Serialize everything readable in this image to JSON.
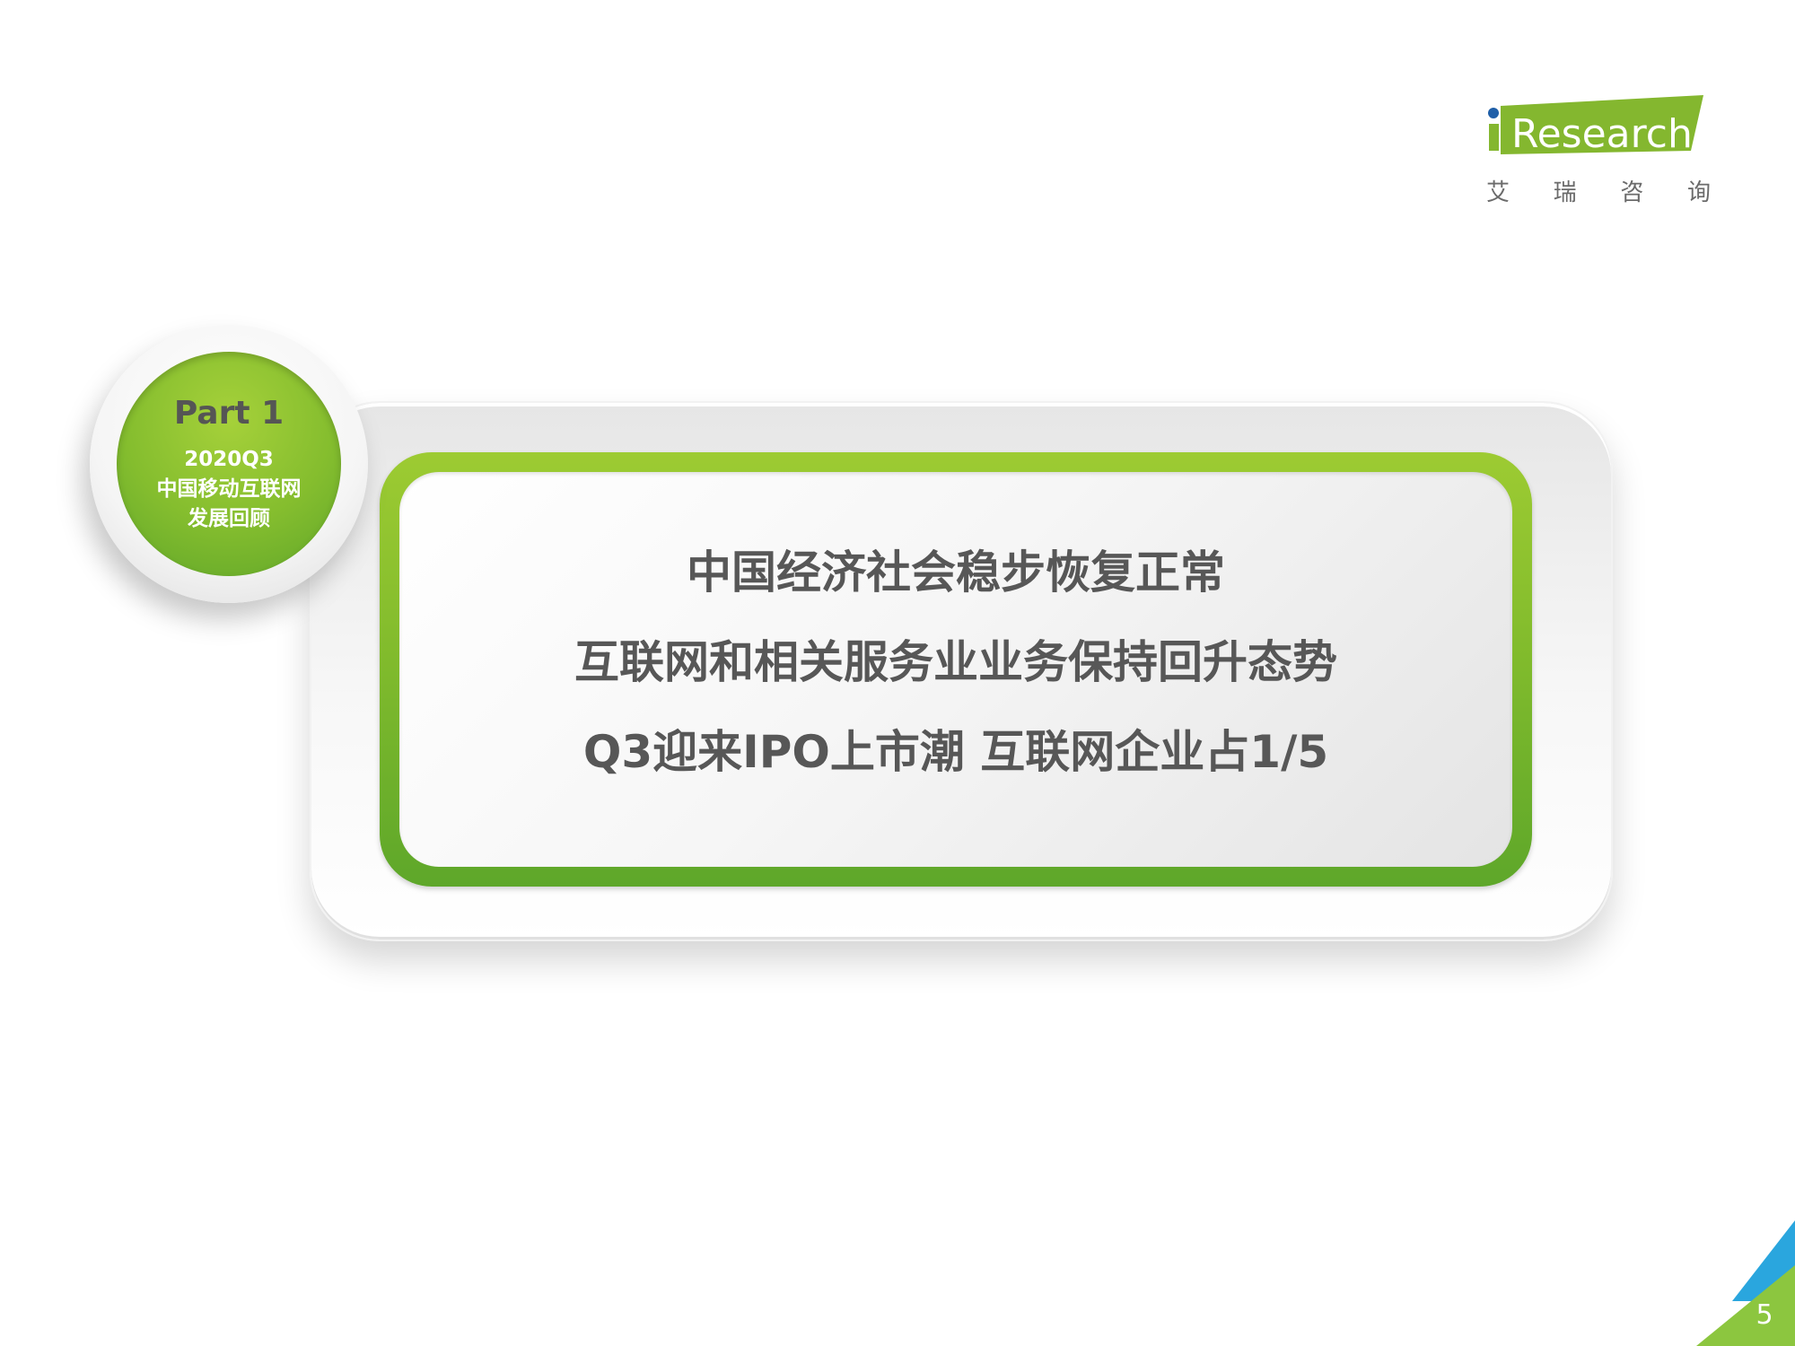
{
  "logo": {
    "wordmark": "Research",
    "cn_chars": [
      "艾",
      "瑞",
      "咨",
      "询"
    ]
  },
  "part": {
    "label": "Part 1",
    "lines": [
      "2020Q3",
      "中国移动互联网",
      "发展回顾"
    ]
  },
  "headlines": [
    "中国经济社会稳步恢复正常",
    "互联网和相关服务业业务保持回升态势",
    "Q3迎来IPO上市潮 互联网企业占1/5"
  ],
  "page_number": "5",
  "colors": {
    "accent_green": "#7fba2c",
    "logo_blue": "#1f5fa8",
    "headline_gray": "#575757",
    "corner_blue": "#2aa6de"
  }
}
